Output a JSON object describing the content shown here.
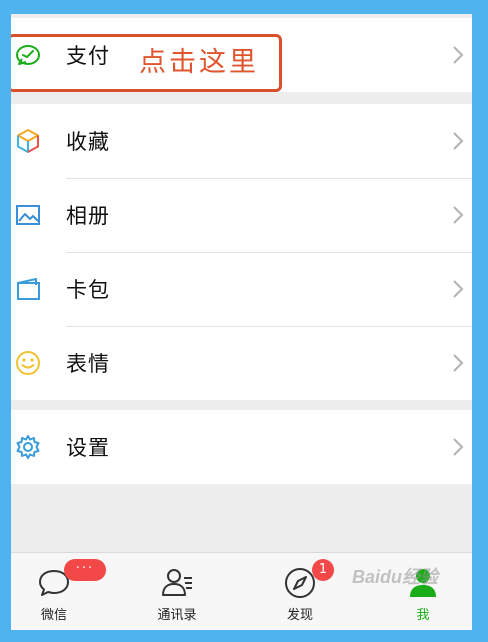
{
  "menu": {
    "pay": {
      "label": "支付",
      "icon": "wallet-pay-icon"
    },
    "collection": {
      "label": "收藏",
      "icon": "cube-icon"
    },
    "album": {
      "label": "相册",
      "icon": "picture-icon"
    },
    "cards": {
      "label": "卡包",
      "icon": "card-wallet-icon"
    },
    "stickers": {
      "label": "表情",
      "icon": "smiley-icon"
    },
    "settings": {
      "label": "设置",
      "icon": "gear-icon"
    }
  },
  "annotation": {
    "text": "点击这里",
    "color": "#E0552E"
  },
  "tabbar": {
    "chats": {
      "label": "微信",
      "badge": "···",
      "icon": "chat-bubble-icon"
    },
    "contacts": {
      "label": "通讯录",
      "icon": "contacts-icon"
    },
    "discover": {
      "label": "发现",
      "badge": "1",
      "icon": "compass-icon"
    },
    "me": {
      "label": "我",
      "icon": "person-icon",
      "active": true
    }
  },
  "watermark": "Baidu经验",
  "colors": {
    "frame": "#4FB3F0",
    "accent_green": "#1AAD19",
    "badge_red": "#F24848",
    "annotation_red": "#D9502B"
  }
}
